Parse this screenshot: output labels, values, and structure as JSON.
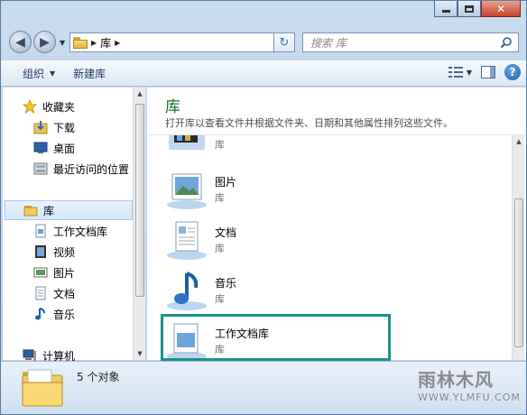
{
  "window": {
    "caption_buttons": [
      "minimize",
      "maximize",
      "close"
    ]
  },
  "address": {
    "location": "库",
    "search_placeholder": "搜索 库"
  },
  "toolbar": {
    "organize_label": "组织",
    "new_library_label": "新建库"
  },
  "sidebar": {
    "favorites": {
      "label": "收藏夹",
      "items": [
        {
          "label": "下载",
          "icon": "downloads-icon"
        },
        {
          "label": "桌面",
          "icon": "desktop-icon"
        },
        {
          "label": "最近访问的位置",
          "icon": "recent-places-icon"
        }
      ]
    },
    "libraries": {
      "label": "库",
      "items": [
        {
          "label": "工作文档库",
          "icon": "document-library-icon"
        },
        {
          "label": "视频",
          "icon": "video-icon"
        },
        {
          "label": "图片",
          "icon": "pictures-icon"
        },
        {
          "label": "文档",
          "icon": "documents-icon"
        },
        {
          "label": "音乐",
          "icon": "music-icon"
        }
      ]
    },
    "computer_label": "计算机"
  },
  "content": {
    "title": "库",
    "subtitle": "打开库以查看文件并根据文件夹、日期和其他属性排列这些文件。",
    "items": [
      {
        "name": "",
        "type": "库",
        "icon": "video-library-icon"
      },
      {
        "name": "图片",
        "type": "库",
        "icon": "pictures-library-icon"
      },
      {
        "name": "文档",
        "type": "库",
        "icon": "documents-library-icon"
      },
      {
        "name": "音乐",
        "type": "库",
        "icon": "music-library-icon"
      },
      {
        "name": "工作文档库",
        "type": "库",
        "icon": "work-library-icon"
      }
    ]
  },
  "status": {
    "count_text": "5 个对象"
  },
  "watermark": {
    "name": "雨林木风",
    "url": "WWW.YLMFU.COM"
  },
  "colors": {
    "title_green": "#1a6c2c",
    "highlight_teal": "#18928a",
    "chrome_blue": "#b9cfe7"
  }
}
